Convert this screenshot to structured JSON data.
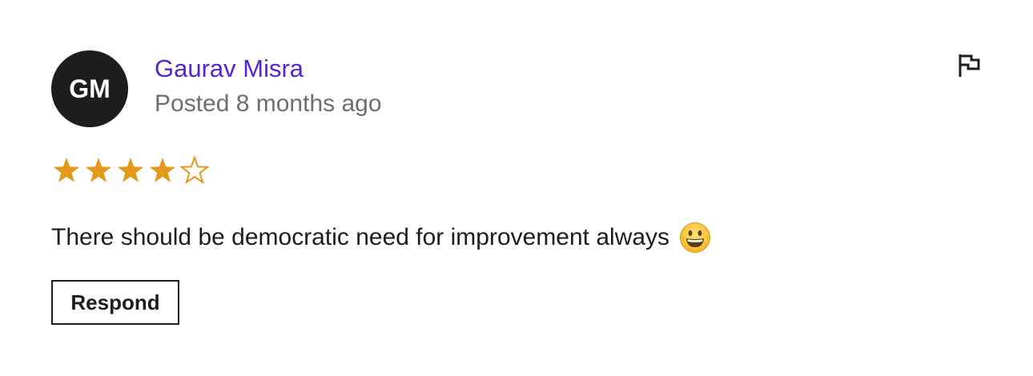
{
  "review": {
    "avatar_initials": "GM",
    "author_name": "Gaurav Misra",
    "posted_text": "Posted 8 months ago",
    "rating": 4,
    "rating_max": 5,
    "comment": "There should be democratic need for improvement always",
    "comment_emoji": "grinning-face-emoji",
    "respond_label": "Respond",
    "flag_icon": "flag-icon"
  },
  "colors": {
    "author_name": "#5624d0",
    "muted_text": "#6a6f73",
    "star": "#e59819",
    "avatar_bg": "#1c1d1f",
    "text": "#1c1d1f"
  }
}
